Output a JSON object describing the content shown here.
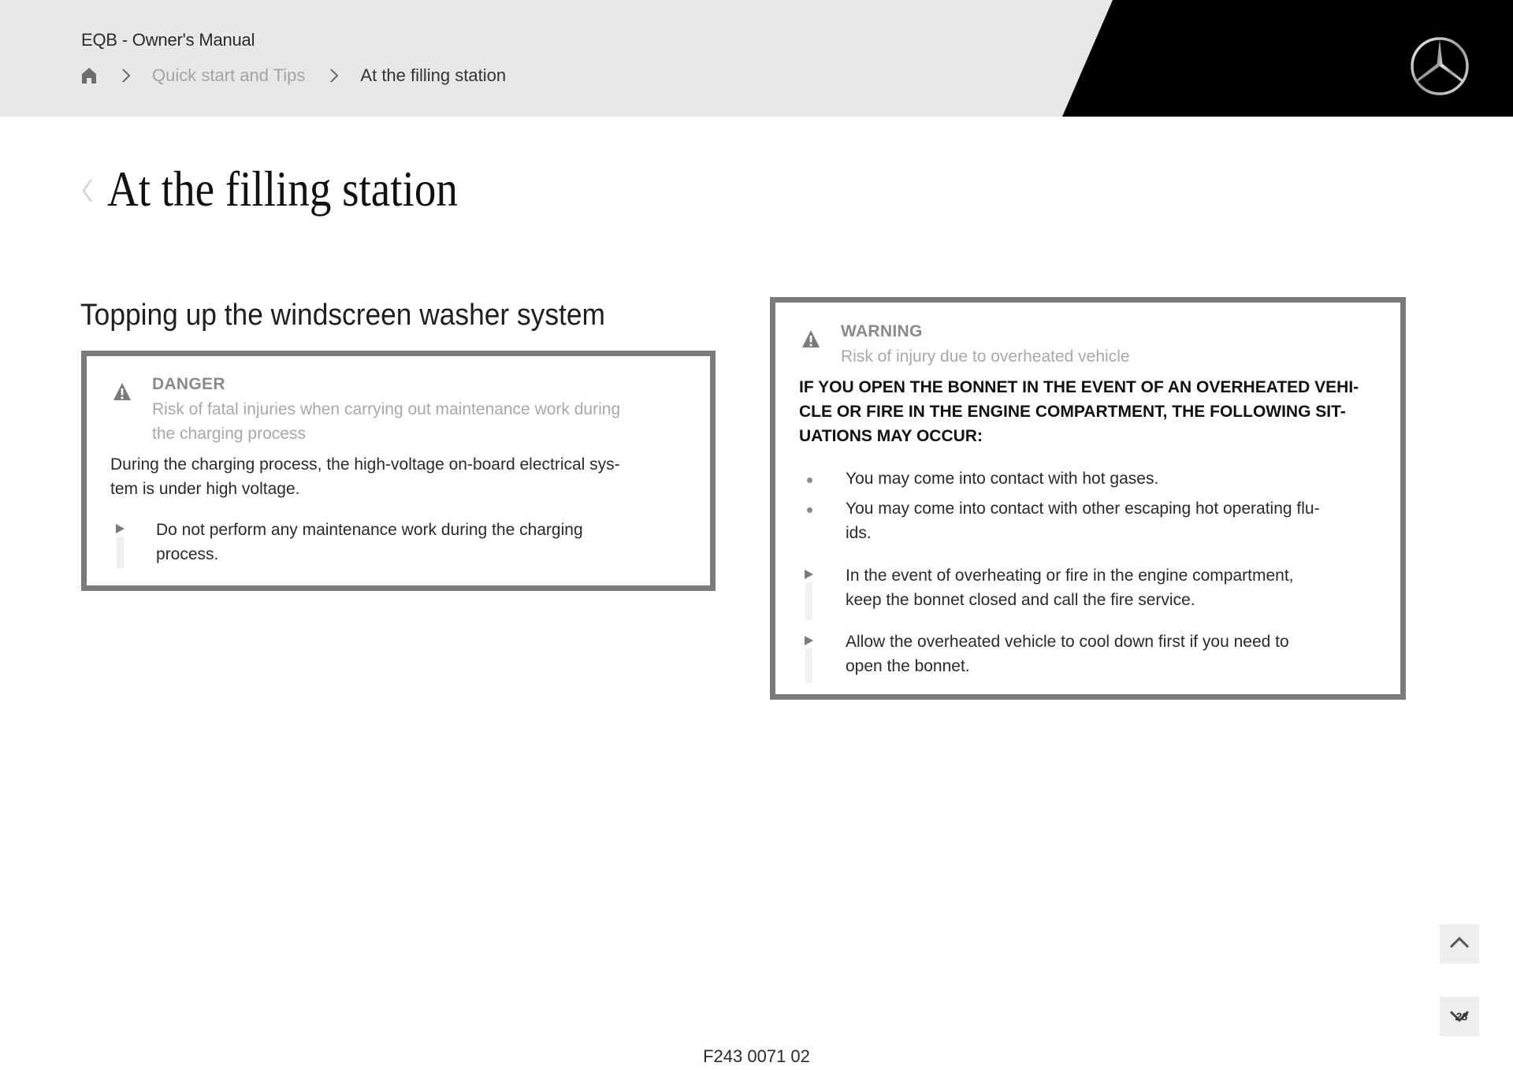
{
  "header": {
    "manual_title": "EQB - Owner's Manual",
    "breadcrumb": {
      "home_icon": "home-icon",
      "separator_icon": "chevron-right-icon",
      "items": [
        {
          "label": "Quick start and Tips"
        },
        {
          "label": "At the filling station"
        }
      ]
    },
    "logo": "mercedes-star-logo"
  },
  "page": {
    "back_icon": "chevron-left-icon",
    "title": "At the filling station"
  },
  "section": {
    "title": "Topping up the windscreen washer system"
  },
  "danger_notice": {
    "icon": "warning-triangle-icon",
    "label": "DANGER",
    "subtitle_lines": [
      "Risk of fatal injuries when carrying out maintenance work during",
      "the charging process"
    ],
    "body_lines": [
      "During the charging process, the high-voltage on-board electrical sys-",
      "tem is under high voltage."
    ],
    "steps": [
      {
        "lines": [
          "Do not perform any maintenance work during the charging",
          "process."
        ]
      }
    ]
  },
  "warning_notice": {
    "icon": "warning-triangle-icon",
    "label": "WARNING",
    "subtitle": "Risk of injury due to overheated vehicle",
    "caps_lines": [
      "IF YOU OPEN THE BONNET IN THE EVENT OF AN OVERHEATED VEHI-",
      "CLE OR FIRE IN THE ENGINE COMPARTMENT, THE FOLLOWING SIT-",
      "UATIONS MAY OCCUR:"
    ],
    "bullets": [
      {
        "lines": [
          "You may come into contact with hot gases."
        ]
      },
      {
        "lines": [
          "You may come into contact with other escaping hot operating flu-",
          "ids."
        ]
      }
    ],
    "steps": [
      {
        "lines": [
          "In the event of overheating or fire in the engine compartment,",
          "keep the bonnet closed and call the fire service."
        ]
      },
      {
        "lines": [
          "Allow the overheated vehicle to cool down first if you need to",
          "open the bonnet."
        ]
      }
    ]
  },
  "nav_buttons": {
    "up_icon": "chevron-up-icon",
    "down_icon": "chevron-down-icon",
    "down_overlay_text": "28"
  },
  "footer": {
    "code": "F243 0071 02"
  },
  "colors": {
    "header_bg": "#e8e8e8",
    "header_black": "#000000",
    "notice_border": "#7b7b7b",
    "muted_text": "#a8a8a8"
  }
}
